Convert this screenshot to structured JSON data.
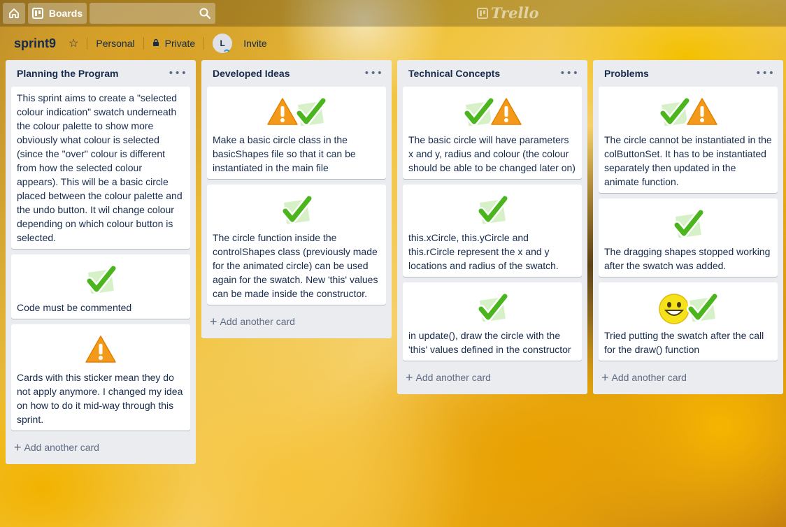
{
  "topbar": {
    "boards_label": "Boards",
    "search_placeholder": "",
    "logo_text": "Trello"
  },
  "board": {
    "title": "sprint9",
    "team": "Personal",
    "visibility": "Private",
    "avatar_initial": "L",
    "invite_label": "Invite"
  },
  "add_card_label": "Add another card",
  "lists": [
    {
      "title": "Planning the Program",
      "cards": [
        {
          "stickers": [],
          "text": "This sprint aims to create a \"selected colour indication\" swatch underneath the colour palette to show more obviously what colour is selected (since the \"over\" colour is different from how the selected colour appears). This will be a basic circle placed between the colour palette and the undo button. It wil change colour depending on which colour button is selected."
        },
        {
          "stickers": [
            "check-icon"
          ],
          "text": "Code must be commented"
        },
        {
          "stickers": [
            "warning-icon"
          ],
          "text": "Cards with this sticker mean they do not apply anymore. I changed my idea on how to do it mid-way through this sprint."
        }
      ]
    },
    {
      "title": "Developed Ideas",
      "cards": [
        {
          "stickers": [
            "warning-icon",
            "check-icon"
          ],
          "text": "Make a basic circle class in the basicShapes file so that it can be instantiated in the main file"
        },
        {
          "stickers": [
            "check-icon"
          ],
          "text": "The circle function inside the controlShapes class (previously made for the animated circle) can be used again for the swatch. New 'this' values can be made inside the constructor."
        }
      ]
    },
    {
      "title": "Technical Concepts",
      "cards": [
        {
          "stickers": [
            "check-icon",
            "warning-icon"
          ],
          "text": "The basic circle will have parameters x and y, radius and colour (the colour should be able to be changed later on)"
        },
        {
          "stickers": [
            "check-icon"
          ],
          "text": "this.xCircle, this.yCircle and this.rCircle represent the x and y locations and radius of the swatch."
        },
        {
          "stickers": [
            "check-icon"
          ],
          "text": "in update(), draw the circle with the 'this' values defined in the constructor"
        }
      ]
    },
    {
      "title": "Problems",
      "cards": [
        {
          "stickers": [
            "check-icon",
            "warning-icon"
          ],
          "text": "The circle cannot be instantiated in the colButtonSet. It has to be instantiated separately then updated in the animate function."
        },
        {
          "stickers": [
            "check-icon"
          ],
          "text": "The dragging shapes stopped working after the swatch was added."
        },
        {
          "stickers": [
            "smiley-icon",
            "check-icon"
          ],
          "text": "Tried putting the swatch after the call for the draw() function"
        }
      ]
    }
  ]
}
